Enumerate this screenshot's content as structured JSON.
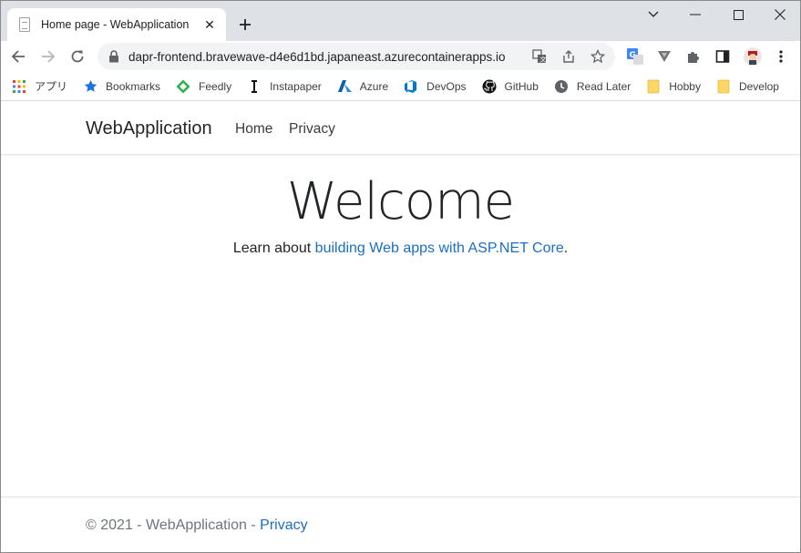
{
  "browser": {
    "tab": {
      "title": "Home page - WebApplication",
      "close": "✕"
    },
    "new_tab": "+",
    "window_controls": {
      "dropdown": "chevron-down-icon",
      "minimize": "minimize-icon",
      "maximize": "maximize-icon",
      "close": "close-icon"
    },
    "address_bar": {
      "url": "dapr-frontend.bravewave-d4e6d1bd.japaneast.azurecontainerapps.io"
    },
    "bookmarks": [
      {
        "label": "アプリ",
        "icon": "apps-grid-icon"
      },
      {
        "label": "Bookmarks",
        "icon": "star-icon"
      },
      {
        "label": "Feedly",
        "icon": "feedly-icon"
      },
      {
        "label": "Instapaper",
        "icon": "instapaper-icon"
      },
      {
        "label": "Azure",
        "icon": "azure-icon"
      },
      {
        "label": "DevOps",
        "icon": "devops-icon"
      },
      {
        "label": "GitHub",
        "icon": "github-icon"
      },
      {
        "label": "Read Later",
        "icon": "read-later-icon"
      },
      {
        "label": "Hobby",
        "icon": "folder-icon"
      },
      {
        "label": "Develop",
        "icon": "folder-icon"
      }
    ]
  },
  "site": {
    "brand": "WebApplication",
    "nav": {
      "home": "Home",
      "privacy": "Privacy"
    },
    "heading": "Welcome",
    "learn_prefix": "Learn about ",
    "learn_link": "building Web apps with ASP.NET Core",
    "learn_suffix": ".",
    "footer_text": "© 2021 - WebApplication - ",
    "footer_link": "Privacy"
  },
  "colors": {
    "link": "#1b6ec2",
    "tabstrip": "#dee1e6",
    "omnibox": "#f1f3f4"
  }
}
